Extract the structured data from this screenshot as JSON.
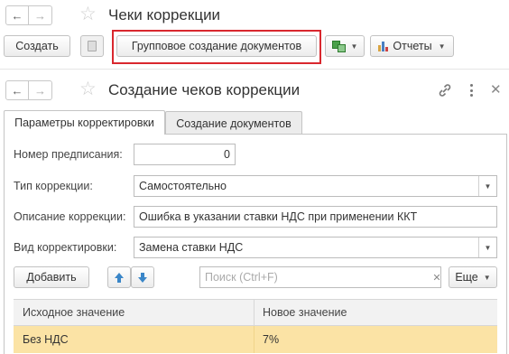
{
  "outer": {
    "title": "Чеки коррекции",
    "create_label": "Создать",
    "group_create_label": "Групповое создание документов",
    "reports_label": "Отчеты"
  },
  "inner": {
    "title": "Создание чеков коррекции",
    "tabs": [
      "Параметры корректировки",
      "Создание документов"
    ],
    "fields": {
      "prescription_label": "Номер предписания:",
      "prescription_value": "0",
      "type_label": "Тип коррекции:",
      "type_value": "Самостоятельно",
      "description_label": "Описание коррекции:",
      "description_value": "Ошибка в указании ставки НДС при применении ККТ",
      "kind_label": "Вид корректировки:",
      "kind_value": "Замена ставки НДС"
    },
    "toolbar": {
      "add_label": "Добавить",
      "search_placeholder": "Поиск (Ctrl+F)",
      "more_label": "Еще"
    },
    "grid": {
      "columns": [
        "Исходное значение",
        "Новое значение"
      ],
      "rows": [
        [
          "Без НДС",
          "7%"
        ]
      ]
    }
  },
  "colors": {
    "highlight": "#d9272e",
    "selected_row": "#fbe3a5",
    "up_down_arrows": "#3a86c8"
  }
}
